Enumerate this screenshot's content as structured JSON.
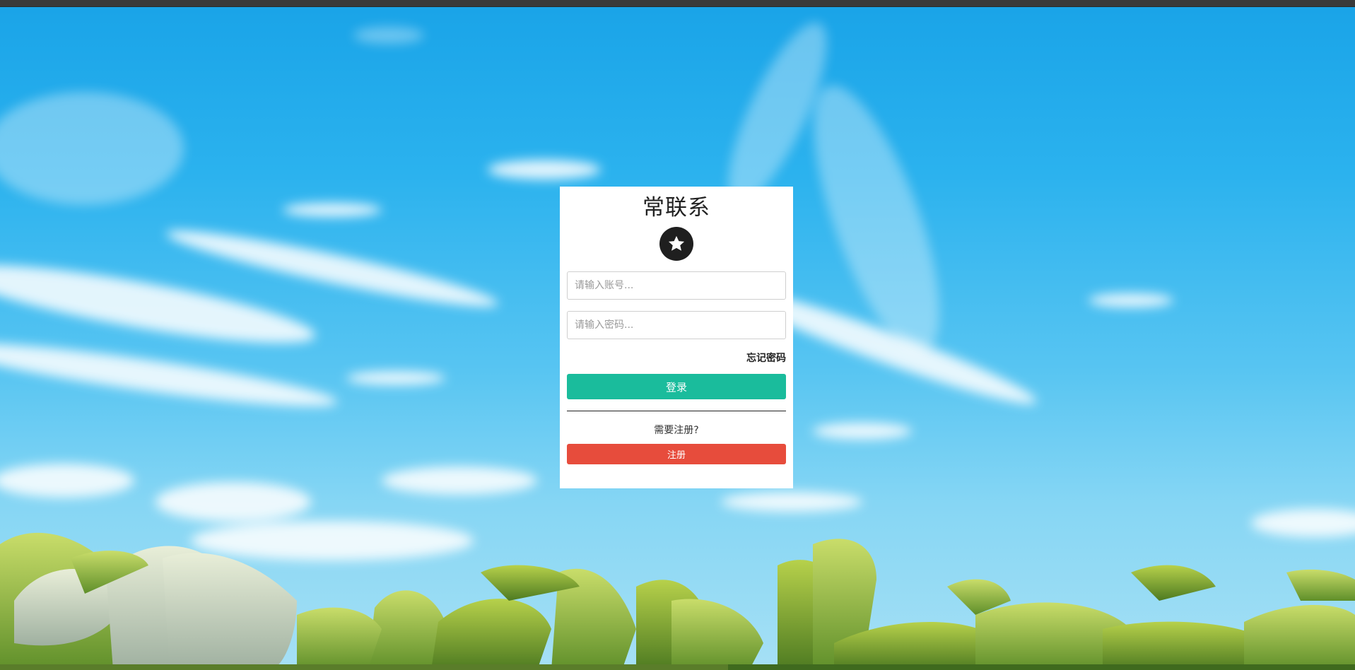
{
  "page": {
    "title": "常联系"
  },
  "logo": {
    "icon": "star-icon"
  },
  "form": {
    "account_placeholder": "请输入账号...",
    "password_placeholder": "请输入密码...",
    "forgot_label": "忘记密码",
    "login_label": "登录",
    "register_hint": "需要注册?",
    "register_label": "注册"
  },
  "colors": {
    "login_button": "#1abc9c",
    "register_button": "#e74c3c",
    "sky": "#2bb2ee"
  }
}
